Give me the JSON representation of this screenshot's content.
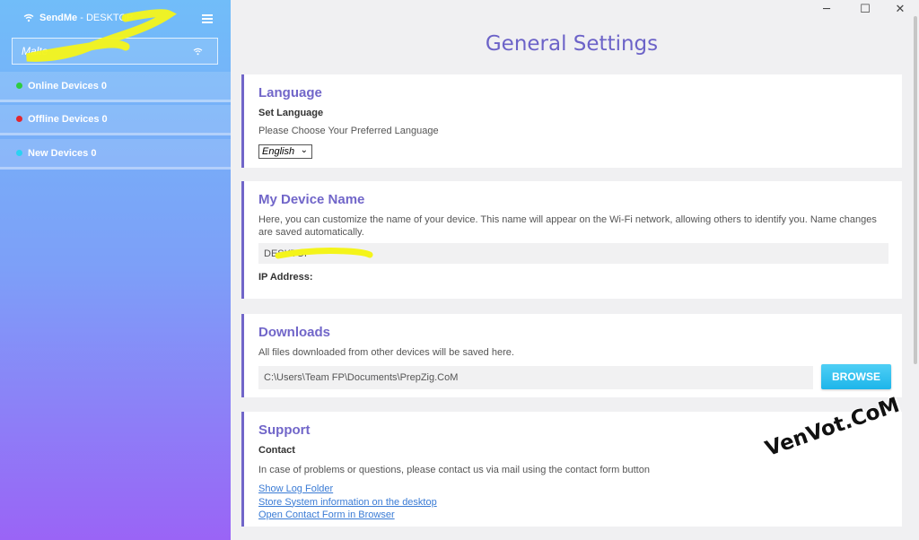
{
  "app": {
    "name": "SendMe",
    "title_suffix": "- DESKTOP",
    "device_value": "Malte"
  },
  "sidebar": {
    "items": [
      {
        "label": "Online Devices 0",
        "color": "#2ecc40"
      },
      {
        "label": "Offline Devices 0",
        "color": "#e3262e"
      },
      {
        "label": "New Devices 0",
        "color": "#2bd2f2"
      }
    ]
  },
  "window": {
    "minimize": "─",
    "maximize": "☐",
    "close": "✕"
  },
  "page_title": "General Settings",
  "language": {
    "title": "Language",
    "subtitle": "Set Language",
    "description": "Please Choose Your Preferred Language",
    "selected": "English"
  },
  "device": {
    "title": "My Device Name",
    "description": "Here, you can customize the name of your device. This name will appear on the Wi-Fi network, allowing others to identify you. Name changes are saved automatically.",
    "name_value": "DESKTOP",
    "ip_label": "IP Address:"
  },
  "downloads": {
    "title": "Downloads",
    "description": "All files downloaded from other devices will be saved here.",
    "path": "C:\\Users\\Team FP\\Documents\\PrepZig.CoM",
    "browse_label": "BROWSE"
  },
  "support": {
    "title": "Support",
    "subtitle": "Contact",
    "description": "In case of problems or questions, please contact us via mail using the contact form button",
    "links": [
      "Show Log Folder",
      "Store System information on the desktop",
      "Open Contact Form in Browser"
    ]
  },
  "watermark": "VenVot.CoM",
  "colors": {
    "accent": "#7166c9",
    "button": "#1db5ea",
    "link": "#3a7bd5",
    "highlight": "#f4f41a"
  }
}
